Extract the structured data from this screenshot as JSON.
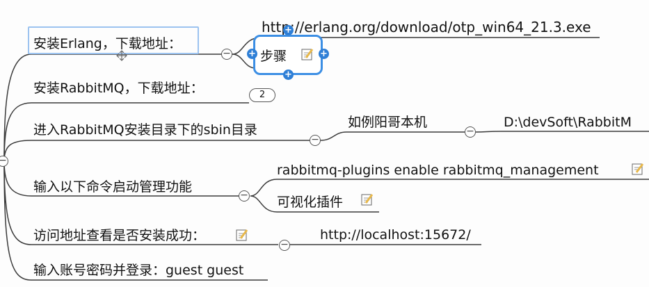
{
  "mindmap": {
    "steps": [
      {
        "label": "安装Erlang，下载地址："
      },
      {
        "label": "安装RabbitMQ，下载地址："
      },
      {
        "label": "进入RabbitMQ安装目录下的sbin目录"
      },
      {
        "label": "输入以下命令启动管理功能"
      },
      {
        "label": "访问地址查看是否安装成功："
      },
      {
        "label": "输入账号密码并登录：guest guest"
      }
    ],
    "erlang_url": "http://erlang.org/download/otp_win64_21.3.exe",
    "popup_label": "步骤",
    "rabbitmq_collapsed_count": "2",
    "sbin_example_label": "如例阳哥本机",
    "sbin_path": "D:\\devSoft\\RabbitM",
    "plugin_command": "rabbitmq-plugins enable rabbitmq_management",
    "plugin_note": "可视化插件",
    "localhost_url": "http://localhost:15672/",
    "collapse_symbol": "−",
    "plus_symbol": "+"
  },
  "colors": {
    "line": "#3a3a3a",
    "selection": "#9cc3f0",
    "popup_border": "#3b8ee4",
    "note_icon": "#e8b84a"
  }
}
